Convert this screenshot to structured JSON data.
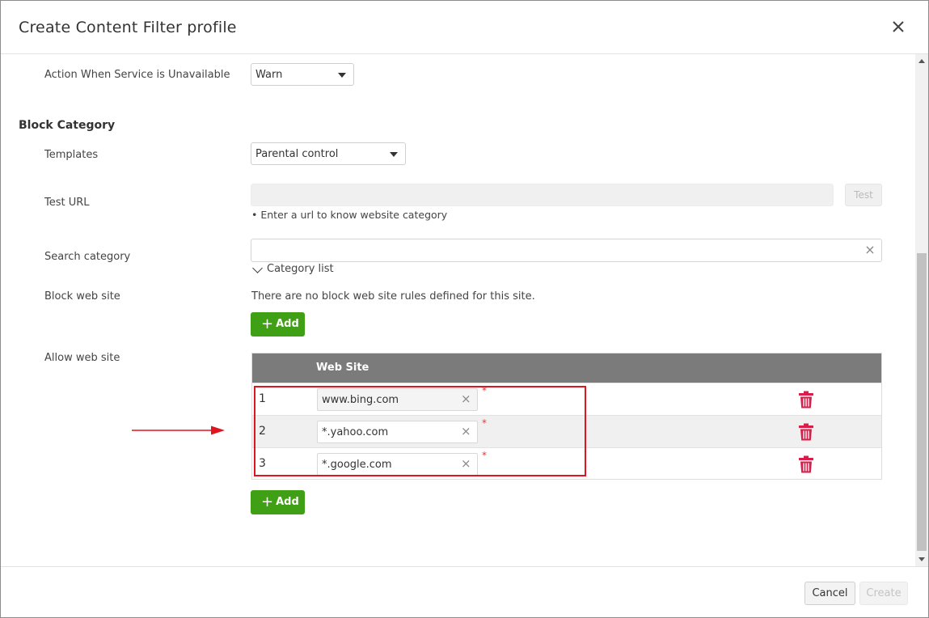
{
  "dialog": {
    "title": "Create Content Filter profile",
    "close_icon": "close-icon"
  },
  "fields": {
    "action_unavailable": {
      "label": "Action When Service is Unavailable",
      "value": "Warn"
    },
    "block_category_title": "Block Category",
    "templates": {
      "label": "Templates",
      "value": "Parental control"
    },
    "test_url": {
      "label": "Test URL",
      "value": "",
      "button": "Test",
      "hint": "• Enter a url to know website category"
    },
    "search_category": {
      "label": "Search category",
      "value": "",
      "clear": "×",
      "category_list": "Category list"
    },
    "block_web_site": {
      "label": "Block web site",
      "empty_text": "There are no block web site rules defined for this site.",
      "add_label": "Add"
    },
    "allow_web_site": {
      "label": "Allow web site",
      "column_header": "Web Site",
      "rows": [
        {
          "num": "1",
          "site": "www.bing.com",
          "required": "*"
        },
        {
          "num": "2",
          "site": "*.yahoo.com",
          "required": "*"
        },
        {
          "num": "3",
          "site": "*.google.com",
          "required": "*"
        }
      ],
      "add_label": "Add",
      "clear": "×"
    }
  },
  "footer": {
    "cancel": "Cancel",
    "create": "Create"
  },
  "colors": {
    "add_green": "#3fa015",
    "trash_red": "#d81e48",
    "highlight_red": "#e0141e",
    "table_header": "#7b7b7b"
  }
}
